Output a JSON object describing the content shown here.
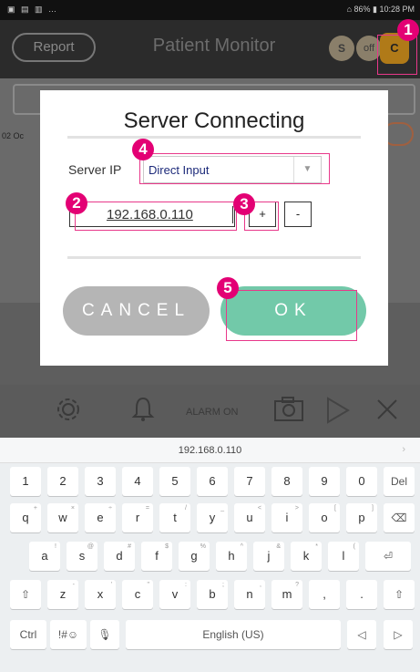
{
  "status_bar": {
    "left_icons": "▣ ▤ ▥ …",
    "right": "⌂ 86% ▮ 10:28 PM"
  },
  "app": {
    "report_label": "Report",
    "title": "Patient Monitor",
    "toggle": {
      "s": "S",
      "off": "off",
      "c": "C"
    }
  },
  "background": {
    "date": "02 Oc"
  },
  "toolbar": {
    "alarm_label": "ALARM ON"
  },
  "dialog": {
    "title": "Server Connecting",
    "server_ip_label": "Server IP",
    "server_ip_mode": "Direct Input",
    "ip_value": "192.168.0.110",
    "plus_label": "+",
    "minus_label": "-",
    "cancel_label": "CANCEL",
    "ok_label": "OK"
  },
  "annotations": [
    "1",
    "2",
    "3",
    "4",
    "5"
  ],
  "keyboard": {
    "suggestion": "192.168.0.110",
    "rows": [
      [
        [
          "1",
          ""
        ],
        [
          "2",
          ""
        ],
        [
          "3",
          ""
        ],
        [
          "4",
          ""
        ],
        [
          "5",
          ""
        ],
        [
          "6",
          ""
        ],
        [
          "7",
          ""
        ],
        [
          "8",
          ""
        ],
        [
          "9",
          ""
        ],
        [
          "0",
          ""
        ],
        [
          "Del",
          ""
        ]
      ],
      [
        [
          "q",
          "+"
        ],
        [
          "w",
          "×"
        ],
        [
          "e",
          "÷"
        ],
        [
          "r",
          "="
        ],
        [
          "t",
          "/"
        ],
        [
          "y",
          "_"
        ],
        [
          "u",
          "<"
        ],
        [
          "i",
          ">"
        ],
        [
          "o",
          "["
        ],
        [
          "p",
          "]"
        ],
        [
          "⌫",
          ""
        ]
      ],
      [
        [
          "a",
          "!"
        ],
        [
          "s",
          "@"
        ],
        [
          "d",
          "#"
        ],
        [
          "f",
          "$"
        ],
        [
          "g",
          "%"
        ],
        [
          "h",
          "^"
        ],
        [
          "j",
          "&"
        ],
        [
          "k",
          "*"
        ],
        [
          "l",
          "("
        ],
        [
          "⏎",
          ""
        ]
      ],
      [
        [
          "⇧",
          ""
        ],
        [
          "z",
          "-"
        ],
        [
          "x",
          "'"
        ],
        [
          "c",
          "\""
        ],
        [
          "v",
          ":"
        ],
        [
          "b",
          ";"
        ],
        [
          "n",
          ","
        ],
        [
          "m",
          "?"
        ],
        [
          ",",
          ""
        ],
        [
          ".",
          ""
        ],
        [
          "⇧",
          ""
        ]
      ],
      [
        [
          "Ctrl",
          ""
        ],
        [
          "!#☺",
          ""
        ],
        [
          "🎙",
          ""
        ],
        [
          "English (US)",
          ""
        ],
        [
          "◁",
          ""
        ],
        [
          "▷",
          ""
        ]
      ]
    ]
  },
  "colors": {
    "ok": "#72c9a9",
    "cancel": "#b5b5b5",
    "annotation": "#e30074"
  }
}
